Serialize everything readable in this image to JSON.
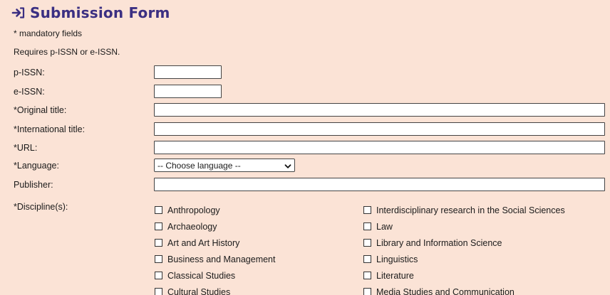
{
  "form": {
    "title": "Submission Form",
    "mandatory_note": "* mandatory fields",
    "requires_note": "Requires p-ISSN or e-ISSN."
  },
  "fields": {
    "p_issn": {
      "label": "p-ISSN:",
      "value": ""
    },
    "e_issn": {
      "label": "e-ISSN:",
      "value": ""
    },
    "original_title": {
      "label": "*Original title:",
      "value": ""
    },
    "international_title": {
      "label": "*International title:",
      "value": ""
    },
    "url": {
      "label": "*URL:",
      "value": ""
    },
    "language": {
      "label": "*Language:",
      "selected": "-- Choose language --"
    },
    "publisher": {
      "label": "Publisher:",
      "value": ""
    }
  },
  "disciplines": {
    "label": "*Discipline(s):",
    "col1": [
      "Anthropology",
      "Archaeology",
      "Art and Art History",
      "Business and Management",
      "Classical Studies",
      "Cultural Studies"
    ],
    "col2": [
      "Interdisciplinary research in the Social Sciences",
      "Law",
      "Library and Information Science",
      "Linguistics",
      "Literature",
      "Media Studies and Communication"
    ]
  },
  "colors": {
    "background": "#fbe3d6",
    "title": "#3b2f82"
  },
  "icons": {
    "title_icon": "sign-in-arrow-icon",
    "select_icon": "chevron-down-icon"
  }
}
